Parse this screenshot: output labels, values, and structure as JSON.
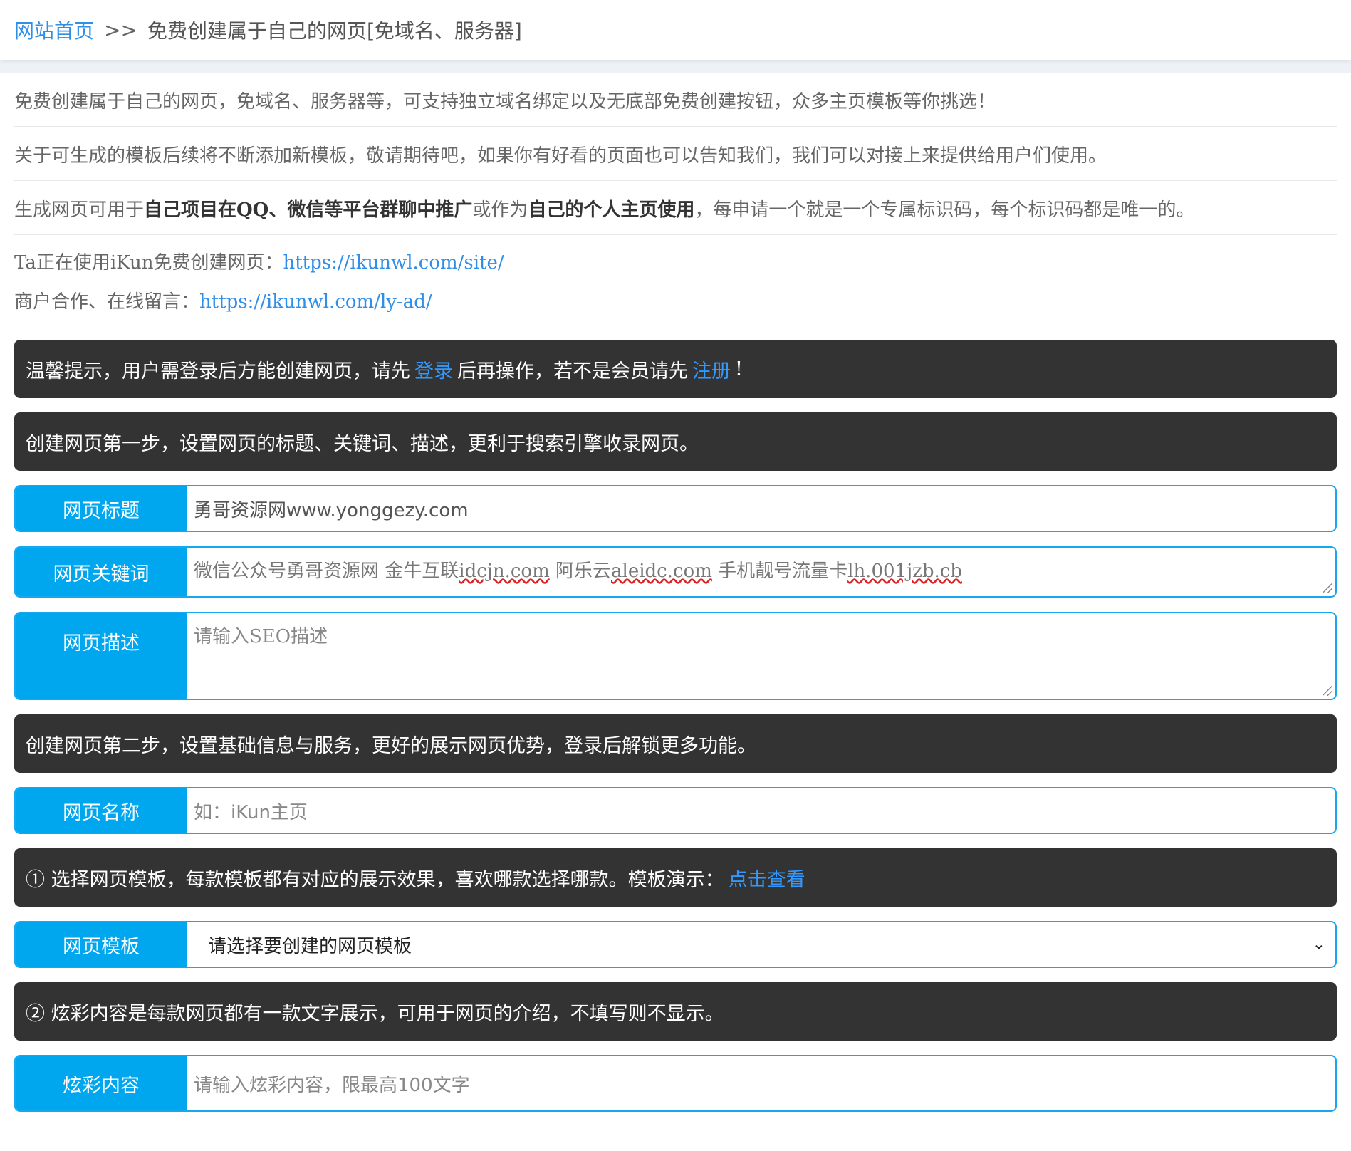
{
  "breadcrumb": {
    "home": "网站首页",
    "separator": ">>",
    "current": "免费创建属于自己的网页[免域名、服务器]"
  },
  "intro": {
    "line1": "免费创建属于自己的网页，免域名、服务器等，可支持独立域名绑定以及无底部免费创建按钮，众多主页模板等你挑选！",
    "line2": "关于可生成的模板后续将不断添加新模板，敬请期待吧，如果你有好看的页面也可以告知我们，我们可以对接上来提供给用户们使用。",
    "line3_a": "生成网页可用于",
    "line3_b": "自己项目在QQ、微信等平台群聊中推广",
    "line3_c": "或作为",
    "line3_d": "自己的个人主页使用",
    "line3_e": "，每申请一个就是一个专属标识码，每个标识码都是唯一的。"
  },
  "links": {
    "site_label": "Ta正在使用iKun免费创建网页：",
    "site_url": "https://ikunwl.com/site/",
    "ad_label": "商户合作、在线留言：",
    "ad_url": "https://ikunwl.com/ly-ad/"
  },
  "notices": {
    "login_a": "温馨提示，用户需登录后方能创建网页，请先",
    "login_link": "登录",
    "login_b": "后再操作，若不是会员请先",
    "register_link": "注册",
    "login_c": "!",
    "step1": "创建网页第一步，设置网页的标题、关键词、描述，更利于搜索引擎收录网页。",
    "step2": "创建网页第二步，设置基础信息与服务，更好的展示网页优势，登录后解锁更多功能。",
    "template_tip": "① 选择网页模板，每款模板都有对应的展示效果，喜欢哪款选择哪款。模板演示：",
    "template_link": "点击查看",
    "color_tip": "② 炫彩内容是每款网页都有一款文字展示，可用于网页的介绍，不填写则不显示。"
  },
  "fields": {
    "title_label": "网页标题",
    "title_value": "勇哥资源网www.yonggezy.com",
    "keywords_label": "网页关键词",
    "keywords_a": "微信公众号勇哥资源网  金牛互联",
    "keywords_b": "idcjn.com",
    "keywords_c": " 阿乐云",
    "keywords_d": "aleidc.com",
    "keywords_e": " 手机靓号流量卡",
    "keywords_f": "lh.001jzb.cb",
    "desc_label": "网页描述",
    "desc_placeholder": "请输入SEO描述",
    "name_label": "网页名称",
    "name_placeholder": "如：iKun主页",
    "template_label": "网页模板",
    "template_selected": "请选择要创建的网页模板",
    "color_label": "炫彩内容",
    "color_placeholder": "请输入炫彩内容，限最高100文字"
  }
}
